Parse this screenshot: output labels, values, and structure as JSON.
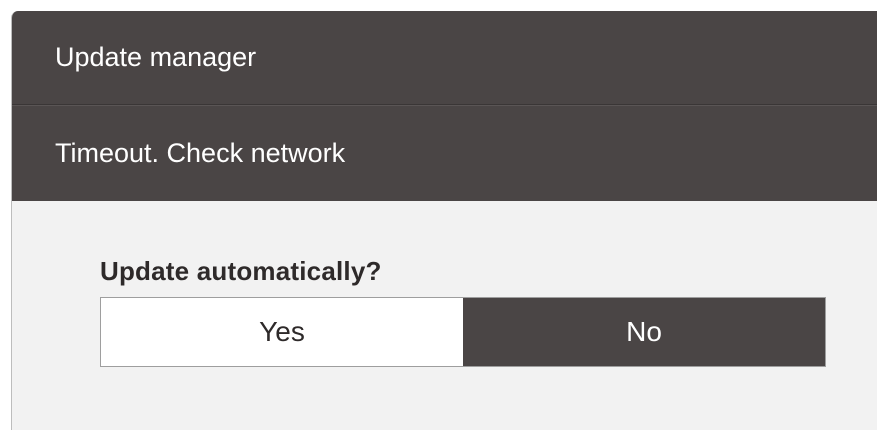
{
  "dialog": {
    "title": "Update manager",
    "status": "Timeout. Check network",
    "question": "Update automatically?",
    "options": {
      "yes_label": "Yes",
      "no_label": "No",
      "selected": "No"
    }
  },
  "colors": {
    "header_bg": "#4a4545",
    "body_bg": "#f2f2f2",
    "selected_bg": "#4a4545",
    "unselected_bg": "#ffffff"
  }
}
